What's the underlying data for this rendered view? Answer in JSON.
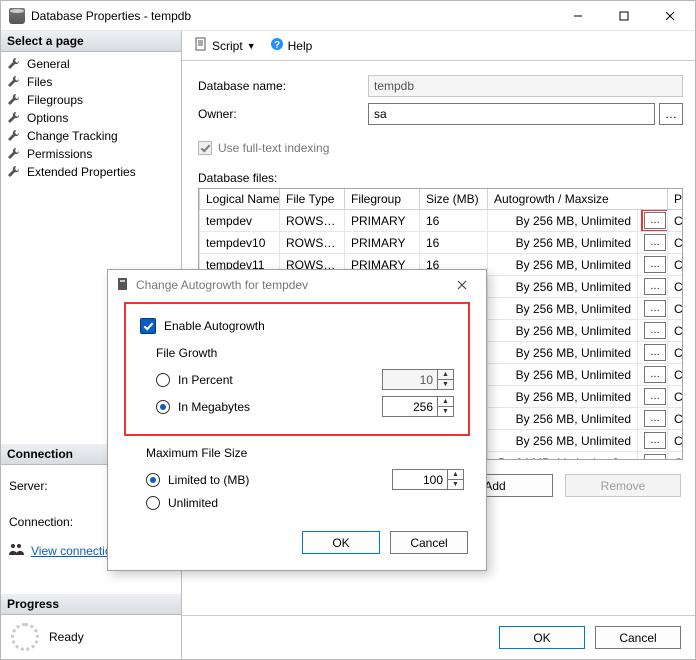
{
  "window": {
    "title": "Database Properties - tempdb"
  },
  "pages": {
    "header": "Select a page",
    "items": [
      "General",
      "Files",
      "Filegroups",
      "Options",
      "Change Tracking",
      "Permissions",
      "Extended Properties"
    ]
  },
  "toolbar": {
    "script": "Script",
    "help": "Help"
  },
  "form": {
    "dbname_label": "Database name:",
    "dbname_value": "tempdb",
    "owner_label": "Owner:",
    "owner_value": "sa",
    "fulltext_label": "Use full-text indexing",
    "files_label": "Database files:"
  },
  "grid": {
    "headers": {
      "logical": "Logical Name",
      "ftype": "File Type",
      "fgroup": "Filegroup",
      "size": "Size (MB)",
      "auto": "Autogrowth / Maxsize",
      "path": "Path"
    },
    "rows": [
      {
        "logical": "tempdev",
        "ftype": "ROWS…",
        "fgroup": "PRIMARY",
        "size": "16",
        "auto": "By 256 MB, Unlimited",
        "path": "C:\\"
      },
      {
        "logical": "tempdev10",
        "ftype": "ROWS…",
        "fgroup": "PRIMARY",
        "size": "16",
        "auto": "By 256 MB, Unlimited",
        "path": "C:\\"
      },
      {
        "logical": "tempdev11",
        "ftype": "ROWS…",
        "fgroup": "PRIMARY",
        "size": "16",
        "auto": "By 256 MB, Unlimited",
        "path": "C:\\"
      },
      {
        "logical": "",
        "ftype": "",
        "fgroup": "",
        "size": "",
        "auto": "By 256 MB, Unlimited",
        "path": "C:\\"
      },
      {
        "logical": "",
        "ftype": "",
        "fgroup": "",
        "size": "",
        "auto": "By 256 MB, Unlimited",
        "path": "C:\\"
      },
      {
        "logical": "",
        "ftype": "",
        "fgroup": "",
        "size": "",
        "auto": "By 256 MB, Unlimited",
        "path": "C:\\"
      },
      {
        "logical": "",
        "ftype": "",
        "fgroup": "",
        "size": "",
        "auto": "By 256 MB, Unlimited",
        "path": "C:\\"
      },
      {
        "logical": "",
        "ftype": "",
        "fgroup": "",
        "size": "",
        "auto": "By 256 MB, Unlimited",
        "path": "C:\\"
      },
      {
        "logical": "",
        "ftype": "",
        "fgroup": "",
        "size": "",
        "auto": "By 256 MB, Unlimited",
        "path": "C:\\"
      },
      {
        "logical": "",
        "ftype": "",
        "fgroup": "",
        "size": "",
        "auto": "By 256 MB, Unlimited",
        "path": "C:\\"
      },
      {
        "logical": "",
        "ftype": "",
        "fgroup": "",
        "size": "",
        "auto": "By 256 MB, Unlimited",
        "path": "C:\\"
      },
      {
        "logical": "",
        "ftype": "",
        "fgroup": "",
        "size": "",
        "auto": "By 64 MB, Limited to 2…",
        "path": "C:\\"
      }
    ]
  },
  "addremove": {
    "add": "Add",
    "remove": "Remove"
  },
  "connection": {
    "header": "Connection",
    "server_label": "Server:",
    "connection_label": "Connection:",
    "link": "View connection"
  },
  "progress": {
    "header": "Progress",
    "status": "Ready"
  },
  "footer": {
    "ok": "OK",
    "cancel": "Cancel"
  },
  "modal": {
    "title": "Change Autogrowth for tempdev",
    "enable": "Enable Autogrowth",
    "fg_label": "File Growth",
    "fg_percent": "In Percent",
    "fg_percent_val": "10",
    "fg_mb": "In Megabytes",
    "fg_mb_val": "256",
    "max_label": "Maximum File Size",
    "max_limited": "Limited to (MB)",
    "max_limited_val": "100",
    "max_unlimited": "Unlimited",
    "ok": "OK",
    "cancel": "Cancel"
  }
}
